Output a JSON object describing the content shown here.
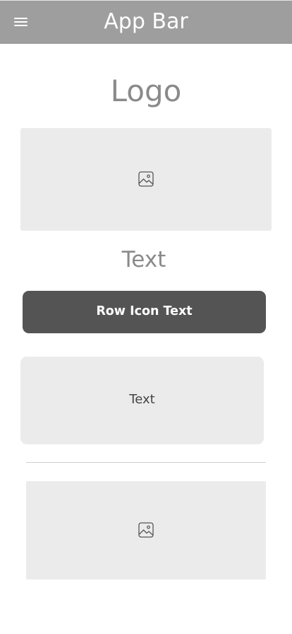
{
  "app_bar": {
    "menu_icon": "hamburger-menu-icon",
    "title": "App Bar"
  },
  "logo": {
    "text": "Logo"
  },
  "image_placeholder_1": {
    "icon": "image-icon"
  },
  "heading": {
    "text": "Text"
  },
  "primary_button": {
    "label": "Row Icon Text"
  },
  "card": {
    "text": "Text"
  },
  "image_placeholder_2": {
    "icon": "image-icon"
  },
  "colors": {
    "app_bar_bg": "#9e9e9e",
    "placeholder_bg": "#ebebeb",
    "button_bg": "#545454",
    "muted_text": "#8a8a8a"
  }
}
